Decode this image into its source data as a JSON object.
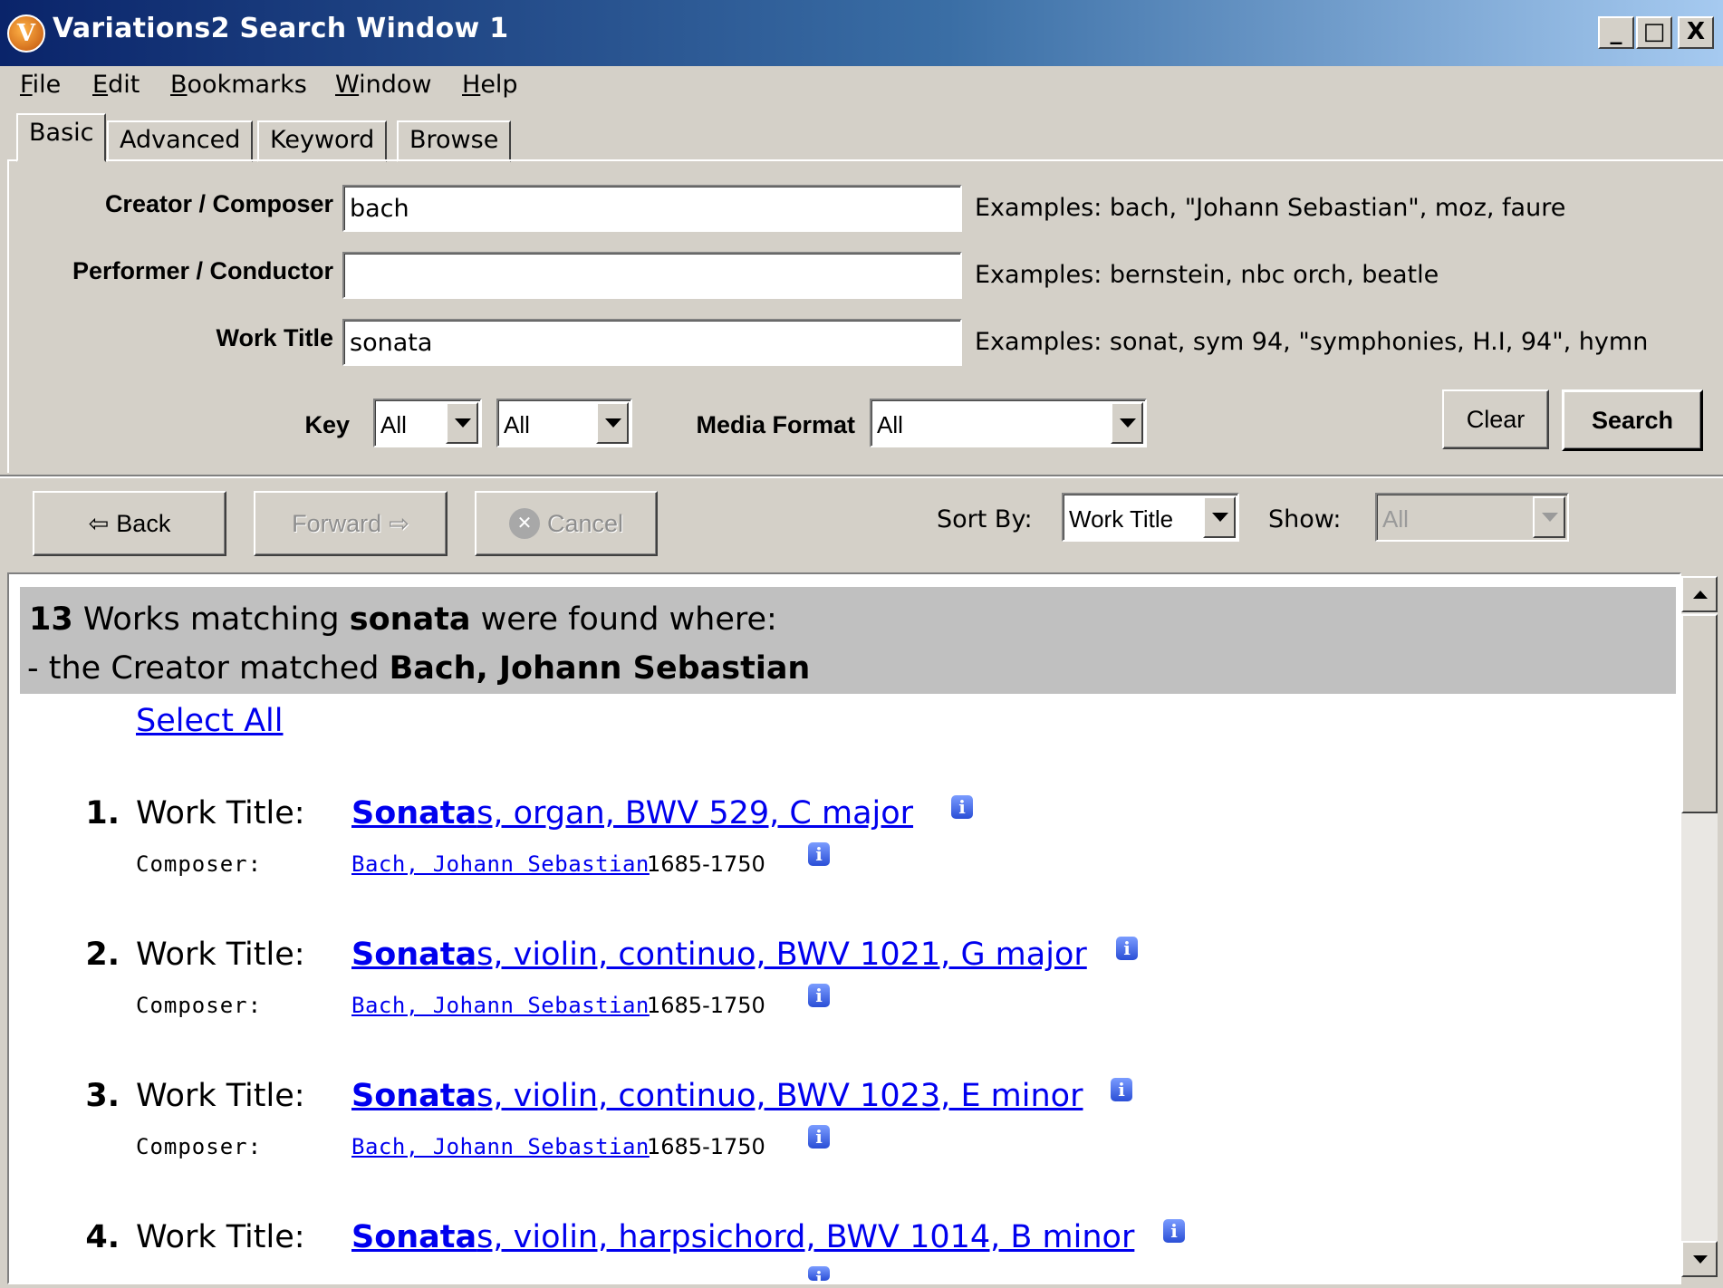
{
  "window": {
    "title": "Variations2 Search Window 1",
    "app_icon": "V",
    "controls": {
      "minimize": "_",
      "maximize": "□",
      "close": "X"
    }
  },
  "menu": {
    "items": [
      {
        "label": "File",
        "mnemonic": "F",
        "rest": "ile"
      },
      {
        "label": "Edit",
        "mnemonic": "E",
        "rest": "dit"
      },
      {
        "label": "Bookmarks",
        "mnemonic": "B",
        "rest": "ookmarks"
      },
      {
        "label": "Window",
        "mnemonic": "W",
        "rest": "indow"
      },
      {
        "label": "Help",
        "mnemonic": "H",
        "rest": "elp"
      }
    ]
  },
  "tabs": [
    {
      "label": "Basic",
      "active": true
    },
    {
      "label": "Advanced"
    },
    {
      "label": "Keyword"
    },
    {
      "label": "Browse"
    }
  ],
  "search": {
    "creator_label": "Creator / Composer",
    "creator_value": "bach",
    "creator_examples": "Examples: bach, \"Johann Sebastian\", moz, faure",
    "performer_label": "Performer / Conductor",
    "performer_value": "",
    "performer_examples": "Examples: bernstein, nbc orch, beatle",
    "title_label": "Work Title",
    "title_value": "sonata",
    "title_examples": "Examples: sonat, sym 94, \"symphonies, H.I, 94\", hymn",
    "key_label": "Key",
    "key_value_1": "All",
    "key_value_2": "All",
    "media_label": "Media Format",
    "media_value": "All",
    "clear_label": "Clear",
    "search_label": "Search"
  },
  "toolbar": {
    "back_label": "Back",
    "forward_label": "Forward",
    "cancel_label": "Cancel",
    "sort_label": "Sort By:",
    "sort_value": "Work Title",
    "show_label": "Show:",
    "show_value": "All"
  },
  "results": {
    "count": "13",
    "summary_pre": " Works matching ",
    "query": "sonata",
    "summary_post": " were found where:",
    "creator_pre": "- the Creator matched ",
    "creator_match": "Bach, Johann Sebastian",
    "select_all": "Select All",
    "work_title_label": "Work Title:",
    "composer_label": "Composer:",
    "items": [
      {
        "num": "1.",
        "match": "Sonata",
        "title_rest": "s, organ, BWV 529, C major ",
        "composer": "Bach, Johann Sebastian",
        "dates": "1685-1750"
      },
      {
        "num": "2.",
        "match": "Sonata",
        "title_rest": "s, violin, continuo, BWV 1021, G major ",
        "composer": "Bach, Johann Sebastian",
        "dates": "1685-1750"
      },
      {
        "num": "3.",
        "match": "Sonata",
        "title_rest": "s, violin, continuo, BWV 1023, E minor ",
        "composer": "Bach, Johann Sebastian",
        "dates": "1685-1750"
      },
      {
        "num": "4.",
        "match": "Sonata",
        "title_rest": "s, violin, harpsichord, BWV 1014, B minor ",
        "composer": "",
        "dates": ""
      }
    ]
  },
  "icons": {
    "info": "info-icon",
    "back": "⇦",
    "forward": "⇨",
    "cancel": "✕"
  }
}
